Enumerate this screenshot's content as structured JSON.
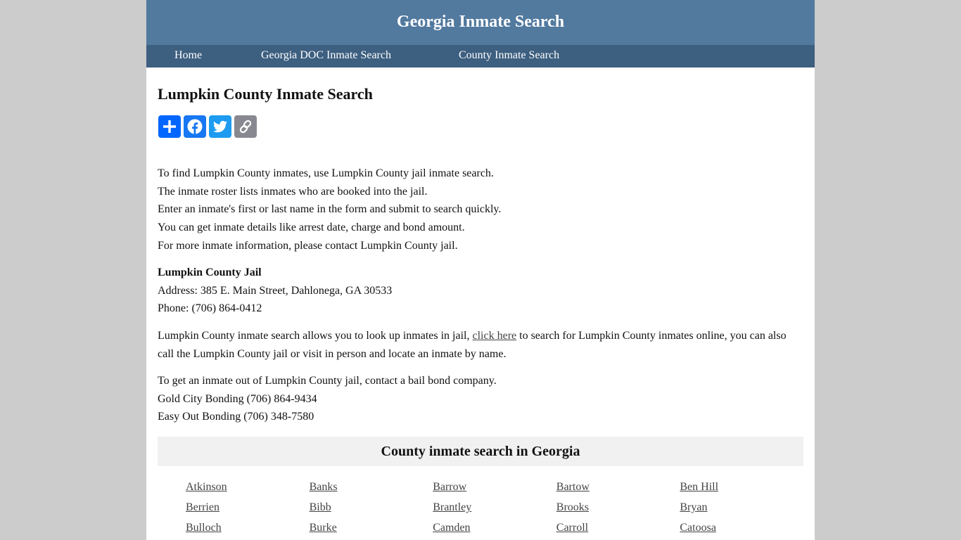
{
  "header": {
    "title": "Georgia Inmate Search"
  },
  "nav": {
    "items": [
      {
        "label": "Home"
      },
      {
        "label": "Georgia DOC Inmate Search"
      },
      {
        "label": "County Inmate Search"
      }
    ]
  },
  "main": {
    "title": "Lumpkin County Inmate Search",
    "share": [
      {
        "name": "share",
        "icon": "plus-icon",
        "color": "#0166ff"
      },
      {
        "name": "facebook",
        "icon": "facebook-icon",
        "color": "#1877f2"
      },
      {
        "name": "twitter",
        "icon": "twitter-icon",
        "color": "#1d9bf0"
      },
      {
        "name": "copy-link",
        "icon": "link-icon",
        "color": "#888990"
      }
    ],
    "intro_lines": [
      "To find Lumpkin County inmates, use Lumpkin County jail inmate search.",
      "The inmate roster lists inmates who are booked into the jail.",
      "Enter an inmate's first or last name in the form and submit to search quickly.",
      "You can get inmate details like arrest date, charge and bond amount.",
      "For more inmate information, please contact Lumpkin County jail."
    ],
    "jail": {
      "name": "Lumpkin County Jail",
      "address": "Address: 385 E. Main Street, Dahlonega, GA 30533",
      "phone": "Phone: (706) 864-0412"
    },
    "search_para": {
      "before": "Lumpkin County inmate search allows you to look up inmates in jail, ",
      "link": "click here",
      "after": " to search for Lumpkin County inmates online, you can also call the Lumpkin County jail or visit in person and locate an inmate by name."
    },
    "bond_lines": [
      "To get an inmate out of Lumpkin County jail, contact a bail bond company.",
      "Gold City Bonding (706) 864-9434",
      "Easy Out Bonding (706) 348-7580"
    ]
  },
  "counties": {
    "title": "County inmate search in Georgia",
    "items": [
      "Atkinson",
      "Banks",
      "Barrow",
      "Bartow",
      "Ben Hill",
      "Berrien",
      "Bibb",
      "Brantley",
      "Brooks",
      "Bryan",
      "Bulloch",
      "Burke",
      "Camden",
      "Carroll",
      "Catoosa"
    ]
  },
  "colors": {
    "header_bg": "#52799e",
    "nav_bg": "#3d5f80",
    "page_bg": "#cccccc",
    "section_bg": "#f1f1f1",
    "link": "#444444"
  }
}
